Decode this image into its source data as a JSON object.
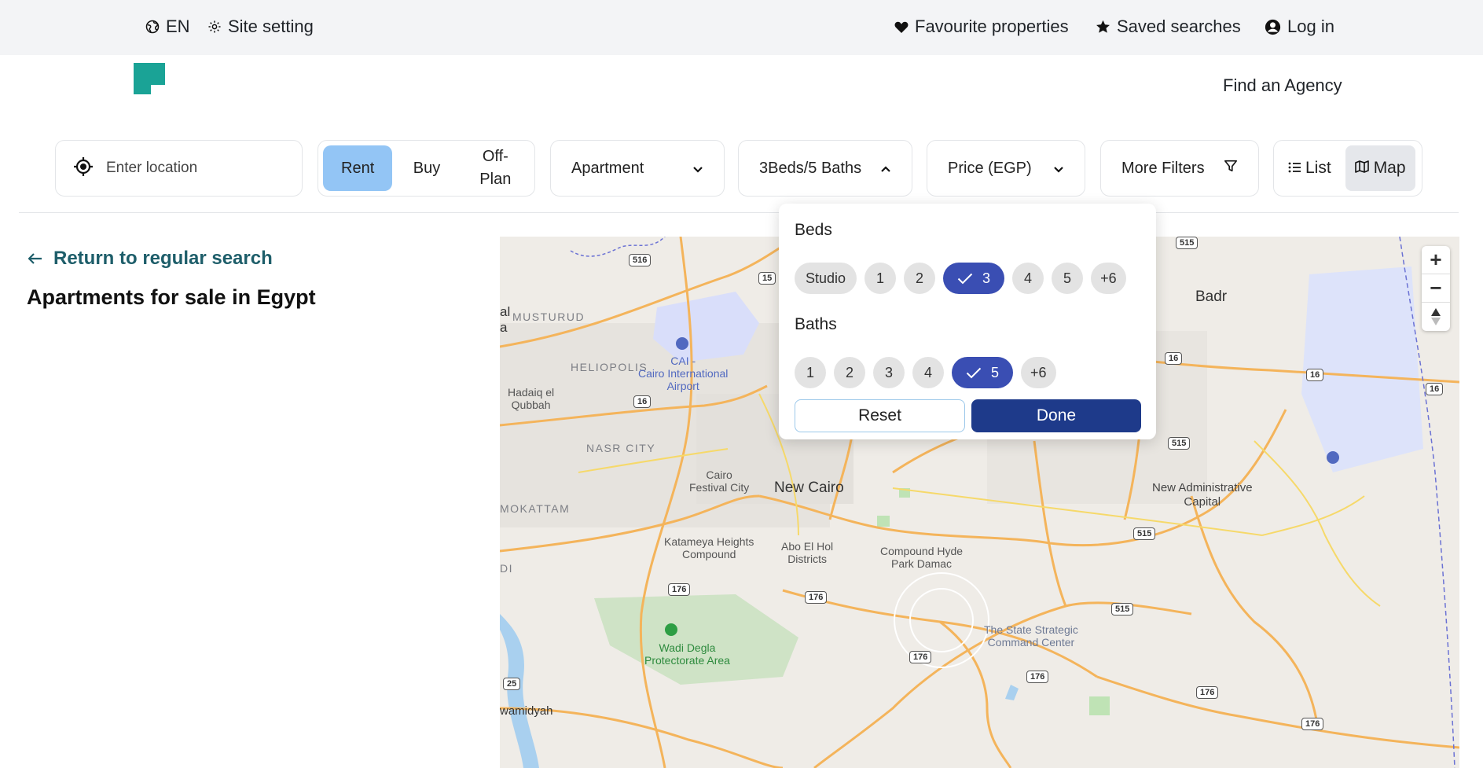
{
  "topbar": {
    "language": "EN",
    "site_setting": "Site setting",
    "favourites": "Favourite properties",
    "saved_searches": "Saved searches",
    "login": "Log in"
  },
  "header": {
    "find_agency": "Find an Agency"
  },
  "filters": {
    "location_placeholder": "Enter location",
    "purpose": [
      "Rent",
      "Buy",
      "Off-\nPlan"
    ],
    "purpose_selected": "Rent",
    "property_type": "Apartment",
    "beds_baths": "3Beds/5 Baths",
    "price": "Price (EGP)",
    "more_filters": "More Filters",
    "view_list": "List",
    "view_map": "Map",
    "view_selected": "Map"
  },
  "sidebar": {
    "return_link": "Return to regular search",
    "page_title": "Apartments for sale in Egypt"
  },
  "popup": {
    "beds_title": "Beds",
    "beds_options": [
      "Studio",
      "1",
      "2",
      "3",
      "4",
      "5",
      "+6"
    ],
    "beds_selected": "3",
    "baths_title": "Baths",
    "baths_options": [
      "1",
      "2",
      "3",
      "4",
      "5",
      "+6"
    ],
    "baths_selected": "5",
    "reset": "Reset",
    "done": "Done"
  },
  "map": {
    "zoom_in": "+",
    "zoom_out": "−",
    "labels": {
      "badr": "Badr",
      "musturud": "MUSTURUD",
      "heliopolis": "HELIOPOLIS",
      "airport_code": "CAI -",
      "airport_name": "Cairo International",
      "airport_word": "Airport",
      "hadaiq": "Hadaiq el",
      "qubbah": "Qubbah",
      "nasr_city": "NASR CITY",
      "festival_1": "Cairo",
      "festival_2": "Festival City",
      "new_cairo": "New Cairo",
      "mokattam": "MOKATTAM",
      "katameya_1": "Katameya Heights",
      "katameya_2": "Compound",
      "abo_1": "Abo El Hol",
      "abo_2": "Districts",
      "hyde_1": "Compound Hyde",
      "hyde_2": "Park Damac",
      "nac_1": "New Administrative",
      "nac_2": "Capital",
      "wadi_1": "Wadi Degla",
      "wadi_2": "Protectorate Area",
      "command_1": "The State Strategic",
      "command_2": "Command Center",
      "hawamidyah": "wamidyah",
      "edge_al": "al",
      "edge_a": "a",
      "edge_di": "DI"
    },
    "shields": [
      "516",
      "15",
      "16",
      "16",
      "16",
      "16",
      "515",
      "515",
      "515",
      "515",
      "176",
      "176",
      "176",
      "176",
      "176",
      "176",
      "176",
      "25"
    ]
  },
  "colors": {
    "accent": "#3a4eb3",
    "done_button": "#1e3a8a",
    "rent_active": "#93c5f5",
    "brand_teal": "#1aa396",
    "link": "#1e5e6a"
  }
}
